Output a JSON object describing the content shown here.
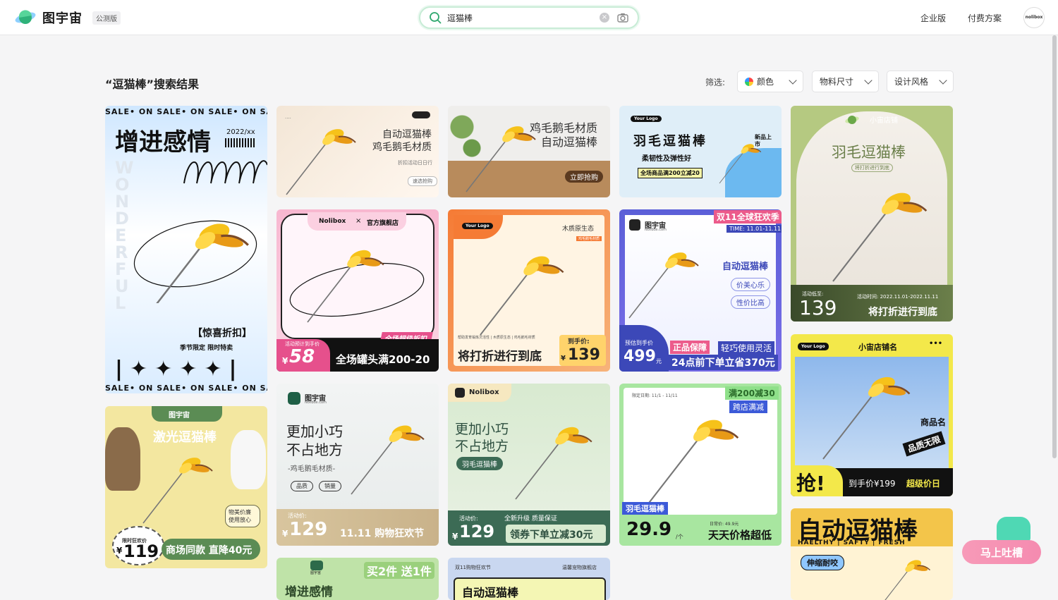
{
  "header": {
    "brand": "图宇宙",
    "beta_badge": "公测版",
    "search_value": "逗猫棒",
    "nav": [
      "企业版",
      "付费方案"
    ],
    "avatar_text": "nolibox"
  },
  "toolbar": {
    "result_title": "“逗猫棒”搜索结果",
    "filter_label": "筛选:",
    "filters": [
      "颜色",
      "物料尺寸",
      "设计风格"
    ]
  },
  "cards": {
    "c1": {
      "marquee": "SALE• ON  SALE• ON  SALE• ON  SA",
      "headline": "增进感情",
      "date": "2022/xx",
      "vertical": "WONDERFUL",
      "promo": "【惊喜折扣】",
      "sub": "季节限定   限时特卖"
    },
    "c2": {
      "line1": "自动逗猫棒",
      "line2": "鸡毛鹅毛材质",
      "small": "折扣活动日日行",
      "btn": "速选抢购"
    },
    "c3": {
      "line1": "鸡毛鹅毛材质",
      "line2": "自动逗猫棒",
      "btn": "立即抢购"
    },
    "c4": {
      "logo": "Your Logo",
      "title": "羽毛逗猫棒",
      "sub": "柔韧性及弹性好",
      "badge": "全场商品满200立减20",
      "new": "新品上市"
    },
    "c5": {
      "shop": "小宙店铺",
      "title": "羽毛逗猫棒",
      "tag": "将打折进行到底",
      "price_label": "活动低至:",
      "price": "139",
      "time": "活动时间: 2022.11.01-2022.11.11",
      "slogan": "将打折进行到底"
    },
    "c6": {
      "brand": "Nolibox",
      "x": "×",
      "store": "官方旗舰店",
      "ribbon": "全场超级折扣",
      "label": "活动预计到手价",
      "currency": "¥",
      "price": "58",
      "slogan": "全场罐头满200-20"
    },
    "c7": {
      "logo": "Your Logo",
      "tag": "木质原生态",
      "tag2": "鸡毛鹅毛材质",
      "small": "帮助发育锻炼灵活性 | 木质原生态 | 鸡毛鹅毛材质",
      "slogan": "将打折进行到底",
      "price_label": "到手价:",
      "currency": "¥",
      "price": "139"
    },
    "c8": {
      "brand": "图宇宙",
      "domain": "Nolibox.com",
      "festival": "双11全球狂欢季",
      "time": "TIME: 11.01-11.11",
      "title": "自动逗猫棒",
      "pill1": "价美心乐",
      "pill2": "性价比高",
      "price_label": "预估到手价",
      "price": "499",
      "unit": "元",
      "s1": "正品保障",
      "s2": "轻巧使用灵活",
      "s3": "24点前下单立省370元"
    },
    "c9": {
      "brand": "图宇宙",
      "title": "激光逗猫棒",
      "bubble": "物美价廉 使用放心",
      "label": "限时狂欢价",
      "currency": "¥",
      "price": "119",
      "slogan": "商场同款 直降40元"
    },
    "c10": {
      "brand": "图宇宙",
      "domain": "Nolibox.com",
      "line1": "更加小巧",
      "line2": "不占地方",
      "sub": "-鸡毛鹅毛材质-",
      "pill1": "品质",
      "pill2": "销量",
      "label": "活动价:",
      "currency": "¥",
      "price": "129",
      "slogan": "11.11 购物狂欢节"
    },
    "c11": {
      "brand": "Nolibox",
      "line1": "更加小巧",
      "line2": "不占地方",
      "pill": "羽毛逗猫棒",
      "label": "活动价:",
      "currency": "¥",
      "price": "129",
      "upgrade": "全新升级 质量保证",
      "slogan": "领券下单立减30元"
    },
    "c12": {
      "date": "限定日期: 11/1 - 11/11",
      "promo": "满200减30",
      "cross": "跨店满减",
      "tag": "羽毛逗猫棒",
      "price": "29.9",
      "unit": "/个",
      "small": "日常价: 49.9元",
      "slogan": "天天价格超低"
    },
    "c13": {
      "logo": "Your Logo",
      "shop": "小宙店铺名",
      "dots": "•••",
      "name": "商品名",
      "quality": "品质无限",
      "grab": "抢!",
      "price": "到手价¥199",
      "deal": "超级价日"
    },
    "c14": {
      "brand": "图宇宙",
      "promo": "买2件 送1件",
      "title": "增进感情"
    },
    "c15": {
      "left": "双11购物狂欢节",
      "right": "温馨宠物旗舰店",
      "title": "自动逗猫棒"
    },
    "c16": {
      "title": "自动逗猫棒",
      "sub": "HAELTHY | SAFTY | FRESH",
      "pill": "伸缩耐咬"
    }
  },
  "feedback": "马上吐槽"
}
